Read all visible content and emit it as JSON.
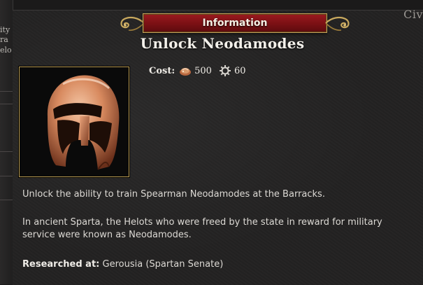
{
  "window": {
    "corner_text": "Civ"
  },
  "left_fragments": [
    "ity",
    "ra",
    "elo"
  ],
  "banner": {
    "title": "Information"
  },
  "tech": {
    "name": "Unlock Neodamodes",
    "cost_label": "Cost:",
    "cost_food": "500",
    "cost_metal": "60",
    "icon": "corinthian-helmet"
  },
  "description": {
    "line1": "Unlock the ability to train Spearman Neodamodes at the Barracks.",
    "line2": "In ancient Sparta, the Helots who were freed by the state in reward for military service were known as Neodamodes.",
    "researched_label": "Researched at:",
    "researched_value": "Gerousia (Spartan Senate)"
  },
  "colors": {
    "banner_red": "#7a1014",
    "gold_border": "#b89a50",
    "panel_bg": "#232222"
  }
}
